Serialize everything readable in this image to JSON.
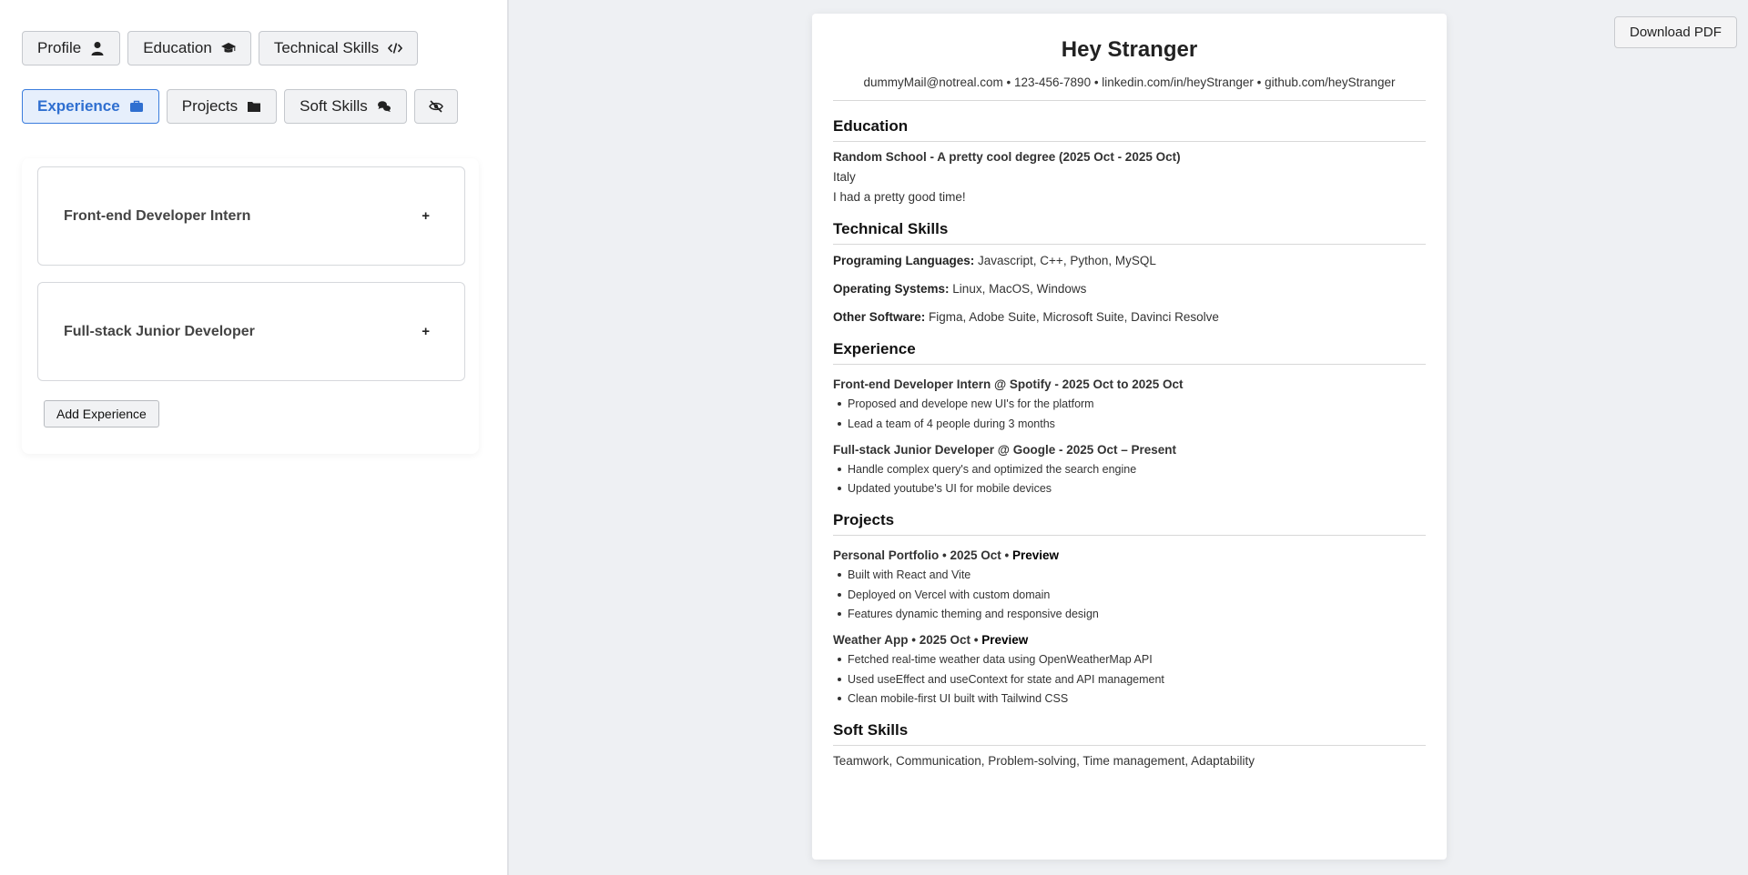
{
  "sidebar": {
    "tabs_row1": [
      {
        "label": "Profile",
        "icon": "user-icon"
      },
      {
        "label": "Education",
        "icon": "graduation-cap-icon"
      },
      {
        "label": "Technical Skills",
        "icon": "code-icon"
      }
    ],
    "tabs_row2": [
      {
        "label": "Experience",
        "icon": "briefcase-icon",
        "active": true
      },
      {
        "label": "Projects",
        "icon": "folder-icon"
      },
      {
        "label": "Soft Skills",
        "icon": "comments-icon"
      },
      {
        "label": "",
        "icon": "eye-slash-icon"
      }
    ],
    "experience_items": [
      {
        "title": "Front-end Developer Intern",
        "toggle": "+"
      },
      {
        "title": "Full-stack Junior Developer",
        "toggle": "+"
      }
    ],
    "add_button": "Add Experience"
  },
  "toolbar": {
    "download_label": "Download PDF"
  },
  "colors": {
    "accent": "#2f6fd0",
    "accent_bg": "#e6effc",
    "sidebar_bg": "#ffffff",
    "canvas_bg": "#eef0f3"
  },
  "resume": {
    "name": "Hey Stranger",
    "contact": "dummyMail@notreal.com • 123-456-7890 • linkedin.com/in/heyStranger • github.com/heyStranger",
    "education": {
      "title": "Education",
      "heading": "Random School - A pretty cool degree (2025 Oct - 2025 Oct)",
      "location": "Italy",
      "description": "I had a pretty good time!"
    },
    "technical": {
      "title": "Technical Skills",
      "languages_label": "Programing Languages:",
      "languages_value": " Javascript, C++, Python, MySQL",
      "os_label": "Operating Systems:",
      "os_value": " Linux, MacOS, Windows",
      "software_label": "Other Software:",
      "software_value": " Figma, Adobe Suite, Microsoft Suite, Davinci Resolve"
    },
    "experience": {
      "title": "Experience",
      "jobs": [
        {
          "heading": "Front-end Developer Intern @ Spotify - 2025 Oct to 2025 Oct",
          "bullets": [
            "Proposed and develope new UI's for the platform",
            "Lead a team of 4 people during 3 months"
          ]
        },
        {
          "heading": "Full-stack Junior Developer @ Google - 2025 Oct – Present",
          "bullets": [
            "Handle complex query's and optimized the search engine",
            "Updated youtube's UI for mobile devices"
          ]
        }
      ]
    },
    "projects": {
      "title": "Projects",
      "items": [
        {
          "heading": "Personal Portfolio • 2025 Oct • ",
          "link": "Preview",
          "bullets": [
            "Built with React and Vite",
            "Deployed on Vercel with custom domain",
            "Features dynamic theming and responsive design"
          ]
        },
        {
          "heading": "Weather App • 2025 Oct • ",
          "link": "Preview",
          "bullets": [
            "Fetched real-time weather data using OpenWeatherMap API",
            "Used useEffect and useContext for state and API management",
            "Clean mobile-first UI built with Tailwind CSS"
          ]
        }
      ]
    },
    "soft_skills": {
      "title": "Soft Skills",
      "text": "Teamwork, Communication, Problem-solving, Time management, Adaptability"
    }
  }
}
